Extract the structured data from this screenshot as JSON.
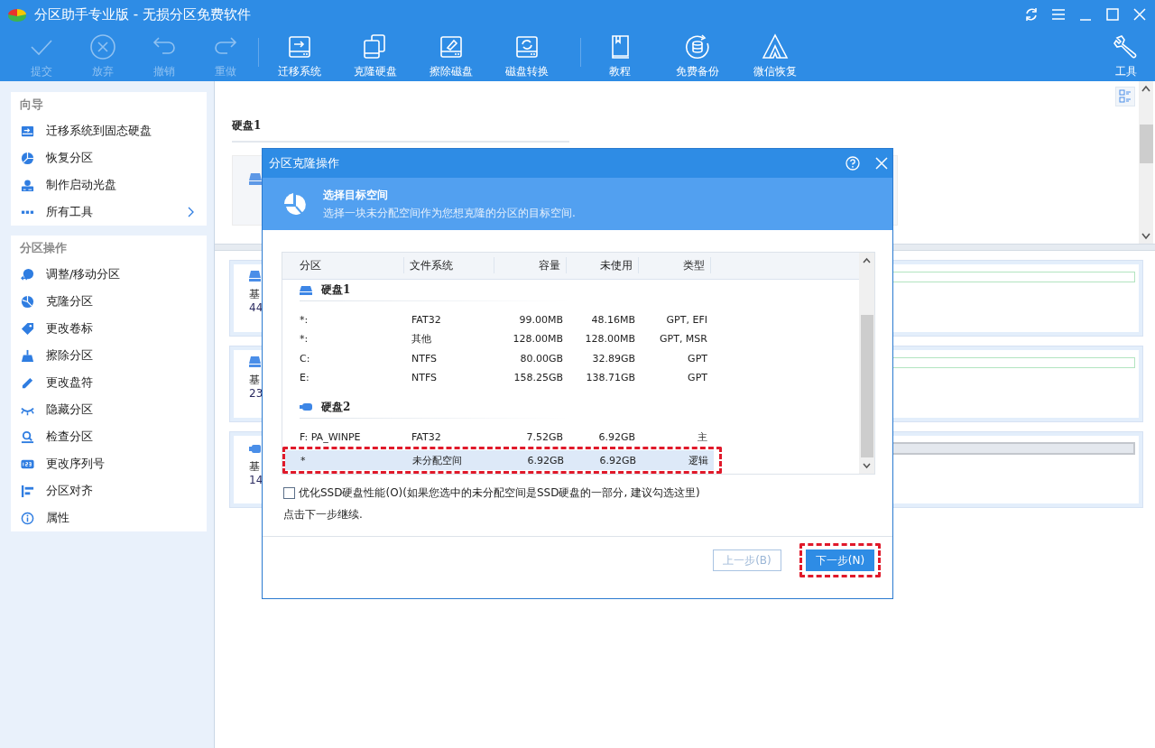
{
  "window": {
    "title": "分区助手专业版 - 无损分区免费软件"
  },
  "toolbar": {
    "items": [
      {
        "label": "提交",
        "disabled": true
      },
      {
        "label": "放弃",
        "disabled": true
      },
      {
        "label": "撤销",
        "disabled": true
      },
      {
        "label": "重做",
        "disabled": true
      },
      {
        "label": "迁移系统",
        "disabled": false
      },
      {
        "label": "克隆硬盘",
        "disabled": false
      },
      {
        "label": "擦除磁盘",
        "disabled": false
      },
      {
        "label": "磁盘转换",
        "disabled": false
      },
      {
        "label": "教程",
        "disabled": false
      },
      {
        "label": "免费备份",
        "disabled": false
      },
      {
        "label": "微信恢复",
        "disabled": false
      },
      {
        "label": "工具",
        "disabled": false
      }
    ]
  },
  "sidebar": {
    "sections": [
      {
        "title": "向导",
        "items": [
          {
            "label": "迁移系统到固态硬盘",
            "has_submenu": false
          },
          {
            "label": "恢复分区",
            "has_submenu": false
          },
          {
            "label": "制作启动光盘",
            "has_submenu": false
          },
          {
            "label": "所有工具",
            "has_submenu": true
          }
        ]
      },
      {
        "title": "分区操作",
        "items": [
          {
            "label": "调整/移动分区",
            "has_submenu": false
          },
          {
            "label": "克隆分区",
            "has_submenu": false
          },
          {
            "label": "更改卷标",
            "has_submenu": false
          },
          {
            "label": "擦除分区",
            "has_submenu": false
          },
          {
            "label": "更改盘符",
            "has_submenu": false
          },
          {
            "label": "隐藏分区",
            "has_submenu": false
          },
          {
            "label": "检查分区",
            "has_submenu": false
          },
          {
            "label": "更改序列号",
            "has_submenu": false
          },
          {
            "label": "分区对齐",
            "has_submenu": false
          },
          {
            "label": "属性",
            "has_submenu": false
          }
        ]
      }
    ]
  },
  "disk_view": {
    "title": "硬盘1"
  },
  "disk_cards": [
    {
      "kind": "disk",
      "label": "基",
      "size": "44"
    },
    {
      "kind": "disk",
      "label": "基",
      "size": "23"
    },
    {
      "kind": "usb",
      "label": "基",
      "size": "14"
    }
  ],
  "dialog": {
    "title": "分区克隆操作",
    "heading": "选择目标空间",
    "subheading": "选择一块未分配空间作为您想克隆的分区的目标空间.",
    "table": {
      "columns": [
        "分区",
        "文件系统",
        "容量",
        "未使用",
        "类型"
      ],
      "rows": [
        {
          "kind": "disk",
          "name": "硬盘1"
        },
        {
          "kind": "partition",
          "cells": [
            "*:",
            "FAT32",
            "99.00MB",
            "48.16MB",
            "GPT, EFI"
          ],
          "selected": false,
          "highlighted": false
        },
        {
          "kind": "partition",
          "cells": [
            "*:",
            "其他",
            "128.00MB",
            "128.00MB",
            "GPT, MSR"
          ],
          "selected": false,
          "highlighted": false
        },
        {
          "kind": "partition",
          "cells": [
            "C:",
            "NTFS",
            "80.00GB",
            "32.89GB",
            "GPT"
          ],
          "selected": false,
          "highlighted": false
        },
        {
          "kind": "partition",
          "cells": [
            "E:",
            "NTFS",
            "158.25GB",
            "138.71GB",
            "GPT"
          ],
          "selected": false,
          "highlighted": false
        },
        {
          "kind": "disk",
          "name": "硬盘2"
        },
        {
          "kind": "partition",
          "cells": [
            "F: PA_WINPE",
            "FAT32",
            "7.52GB",
            "6.92GB",
            "主"
          ],
          "selected": false,
          "highlighted": false
        },
        {
          "kind": "partition",
          "cells": [
            "*",
            "未分配空间",
            "6.92GB",
            "6.92GB",
            "逻辑"
          ],
          "selected": true,
          "highlighted": true
        }
      ]
    },
    "checkbox": {
      "label": "优化SSD硬盘性能(O)(如果您选中的未分配空间是SSD硬盘的一部分, 建议勾选这里)",
      "checked": false
    },
    "hint": "点击下一步继续.",
    "buttons": [
      {
        "label": "上一步(B)",
        "kind": "secondary",
        "disabled": true,
        "highlighted": false
      },
      {
        "label": "下一步(N)",
        "kind": "primary",
        "disabled": false,
        "highlighted": true
      }
    ]
  }
}
